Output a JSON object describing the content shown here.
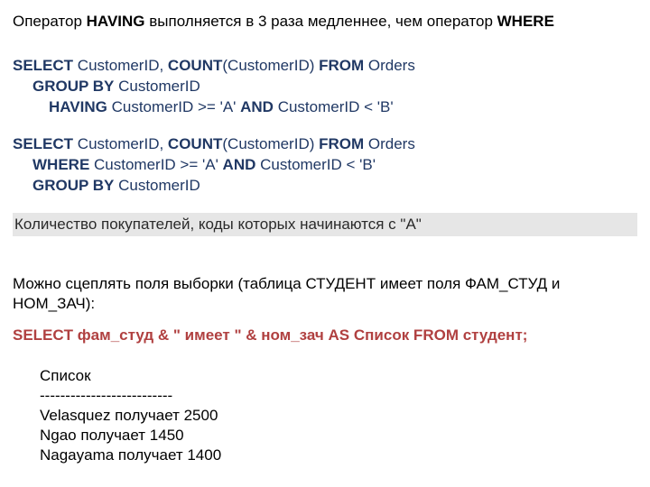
{
  "heading": {
    "pre": "Оператор ",
    "having": "HAVING",
    "mid": " выполняется в 3 раза медленнее, чем оператор ",
    "where": "WHERE"
  },
  "sql1": {
    "l1a": "SELECT",
    "l1b": " CustomerID, ",
    "l1c": "COUNT",
    "l1d": "(CustomerID)  ",
    "l1e": "FROM",
    "l1f": " Orders",
    "l2a": "GROUP BY",
    "l2b": " CustomerID",
    "l3a": "HAVING",
    "l3b": " CustomerID >= 'A' ",
    "l3c": "AND",
    "l3d": " CustomerID < 'B'"
  },
  "sql2": {
    "l1a": "SELECT",
    "l1b": " CustomerID, ",
    "l1c": "COUNT",
    "l1d": "(CustomerID)  ",
    "l1e": "FROM",
    "l1f": " Orders",
    "l2a": "WHERE",
    "l2b": " CustomerID >= 'A' ",
    "l2c": "AND",
    "l2d": " CustomerID < 'B'",
    "l3a": "GROUP BY",
    "l3b": " CustomerID"
  },
  "highlight": "Количество покупателей, коды которых начинаются с \"A\"",
  "concat_text": "Можно сцеплять поля выборки (таблица СТУДЕНТ имеет поля ФАМ_СТУД и НОМ_ЗАЧ):",
  "concat_sql": "SELECT фам_студ & \" имеет \" & ном_зач AS Список FROM студент;",
  "result": {
    "header": "Список",
    "divider": "--------------------------",
    "rows": [
      "Velasquez получает 2500",
      "Ngao получает 1450",
      "Nagayama получает 1400"
    ]
  }
}
